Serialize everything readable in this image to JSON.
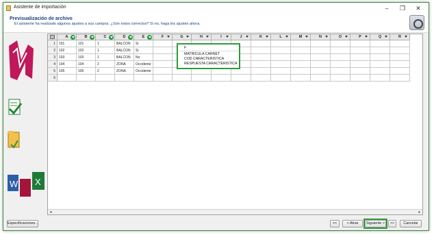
{
  "window": {
    "title": "Asistente de importación",
    "controls": {
      "minimize": "–",
      "restore": "❐",
      "close": "✕"
    }
  },
  "header": {
    "title": "Previsualización de archivo",
    "subtitle": "El asistente ha realizado algunos ajustes a sus campos. ¿Son estos correctos? Si no, haga los ajustes ahora."
  },
  "grid": {
    "columns": [
      {
        "label": "A",
        "mapped": true
      },
      {
        "label": "B",
        "mapped": true
      },
      {
        "label": "C",
        "mapped": true
      },
      {
        "label": "D",
        "mapped": true
      },
      {
        "label": "E",
        "mapped": true
      },
      {
        "label": "F",
        "mapped": false
      },
      {
        "label": "G",
        "mapped": false
      },
      {
        "label": "H",
        "mapped": false
      },
      {
        "label": "I",
        "mapped": false
      },
      {
        "label": "J",
        "mapped": false
      },
      {
        "label": "K",
        "mapped": false
      },
      {
        "label": "L",
        "mapped": false
      },
      {
        "label": "M",
        "mapped": false
      },
      {
        "label": "N",
        "mapped": false
      },
      {
        "label": "O",
        "mapped": false
      },
      {
        "label": "P",
        "mapped": false
      },
      {
        "label": "Q",
        "mapped": false
      },
      {
        "label": "R",
        "mapped": false
      }
    ],
    "rows": [
      {
        "num": "1",
        "cells": [
          "101",
          "101",
          "1",
          "BALCON",
          "Si"
        ]
      },
      {
        "num": "2",
        "cells": [
          "102",
          "102",
          "1",
          "BALCON",
          "Si"
        ]
      },
      {
        "num": "3",
        "cells": [
          "103",
          "103",
          "1",
          "BALCON",
          "No"
        ]
      },
      {
        "num": "4",
        "cells": [
          "104",
          "104",
          "2",
          "ZONA",
          "Occidente"
        ]
      },
      {
        "num": "5",
        "cells": [
          "105",
          "105",
          "2",
          "ZONA",
          "Occidente"
        ]
      },
      {
        "num": "6",
        "cells": [
          "",
          "",
          "",
          "",
          ""
        ]
      }
    ]
  },
  "dropdown": {
    "header": "F",
    "options": [
      "MATRICULA CARNET",
      "COD CARACTERISTICA",
      "RESPUESTA CARACTERISTICA"
    ]
  },
  "footer": {
    "specs_label": "Especificaciones...",
    "first_label": "<<",
    "back_label": "< Atras",
    "next_label": "Siguiente >",
    "last_label": ">>",
    "cancel_label": "Cancelar"
  },
  "colors": {
    "accent_green": "#2f9a3a",
    "header_text": "#1a3f7a",
    "logo_magenta": "#c0185a"
  },
  "icons": [
    "app-icon",
    "wizard-database-icon",
    "brand-logo",
    "excel-check-icon",
    "folder-icon",
    "document-types-icon",
    "dropdown-arrow-icon",
    "mapped-column-icon"
  ]
}
